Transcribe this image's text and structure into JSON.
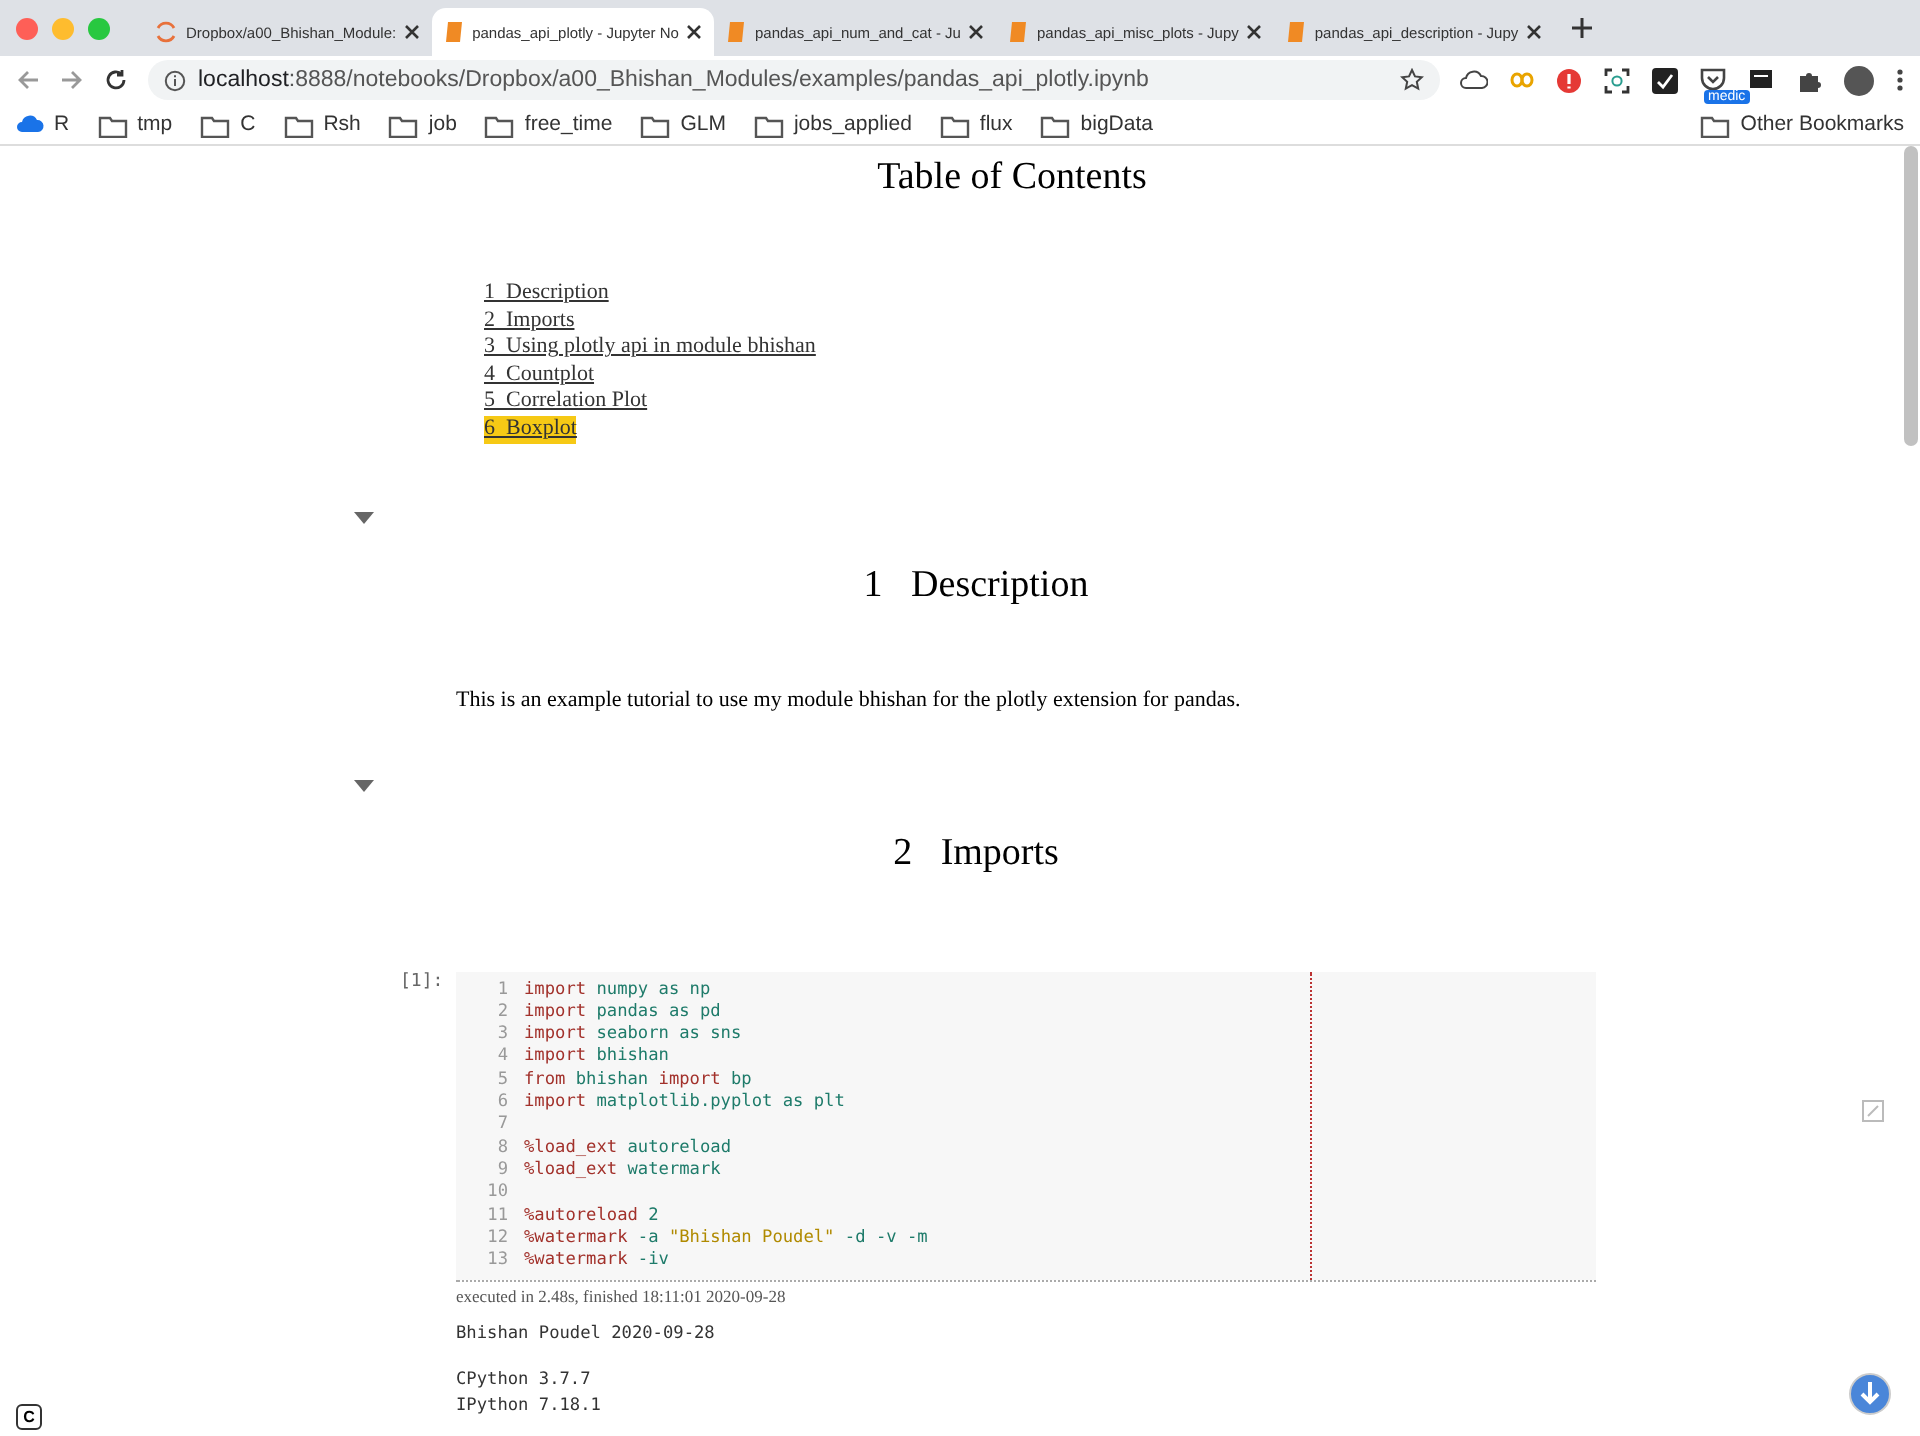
{
  "tabs": [
    {
      "title": "Dropbox/a00_Bhishan_Module:",
      "kind": "loading",
      "selected": false
    },
    {
      "title": "pandas_api_plotly - Jupyter No",
      "kind": "notebook",
      "selected": true
    },
    {
      "title": "pandas_api_num_and_cat - Ju",
      "kind": "notebook",
      "selected": false
    },
    {
      "title": "pandas_api_misc_plots - Jupy",
      "kind": "notebook",
      "selected": false
    },
    {
      "title": "pandas_api_description - Jupy",
      "kind": "notebook",
      "selected": false
    }
  ],
  "address_bar": {
    "host": "localhost",
    "path": ":8888/notebooks/Dropbox/a00_Bhishan_Modules/examples/pandas_api_plotly.ipynb"
  },
  "extension_badge": "medic",
  "bookmarks": [
    {
      "label": "R",
      "kind": "cloud"
    },
    {
      "label": "tmp",
      "kind": "folder"
    },
    {
      "label": "C",
      "kind": "folder"
    },
    {
      "label": "Rsh",
      "kind": "folder"
    },
    {
      "label": "job",
      "kind": "folder"
    },
    {
      "label": "free_time",
      "kind": "folder"
    },
    {
      "label": "GLM",
      "kind": "folder"
    },
    {
      "label": "jobs_applied",
      "kind": "folder"
    },
    {
      "label": "flux",
      "kind": "folder"
    },
    {
      "label": "bigData",
      "kind": "folder"
    }
  ],
  "other_bookmarks": "Other Bookmarks",
  "toc": {
    "title": "Table of Contents",
    "items": [
      {
        "number": "1",
        "label": "Description",
        "selected": false
      },
      {
        "number": "2",
        "label": "Imports",
        "selected": false
      },
      {
        "number": "3",
        "label": "Using plotly api in module bhishan",
        "selected": false
      },
      {
        "number": "4",
        "label": "Countplot",
        "selected": false
      },
      {
        "number": "5",
        "label": "Correlation Plot",
        "selected": false
      },
      {
        "number": "6",
        "label": "Boxplot",
        "selected": true
      }
    ]
  },
  "sections": [
    {
      "number": "1",
      "title": "Description",
      "text": "This is an example tutorial to use my module bhishan for the plotly extension for pandas."
    },
    {
      "number": "2",
      "title": "Imports"
    }
  ],
  "code_cell": {
    "prompt": "[1]:",
    "lines": [
      {
        "number": "1",
        "tokens": [
          {
            "kind": "kw",
            "text": "import"
          },
          {
            "kind": "id",
            "text": " numpy as np"
          }
        ]
      },
      {
        "number": "2",
        "tokens": [
          {
            "kind": "kw",
            "text": "import"
          },
          {
            "kind": "id",
            "text": " pandas as pd"
          }
        ]
      },
      {
        "number": "3",
        "tokens": [
          {
            "kind": "kw",
            "text": "import"
          },
          {
            "kind": "id",
            "text": " seaborn as sns"
          }
        ]
      },
      {
        "number": "4",
        "tokens": [
          {
            "kind": "kw",
            "text": "import"
          },
          {
            "kind": "id",
            "text": " bhishan"
          }
        ]
      },
      {
        "number": "5",
        "tokens": [
          {
            "kind": "kw",
            "text": "from"
          },
          {
            "kind": "id",
            "text": " bhishan "
          },
          {
            "kind": "kw",
            "text": "import"
          },
          {
            "kind": "id",
            "text": " bp"
          }
        ]
      },
      {
        "number": "6",
        "tokens": [
          {
            "kind": "kw",
            "text": "import"
          },
          {
            "kind": "id",
            "text": " matplotlib.pyplot as plt"
          }
        ]
      },
      {
        "number": "7"
      },
      {
        "number": "8",
        "tokens": [
          {
            "kind": "kw",
            "text": "%load_ext"
          },
          {
            "kind": "id",
            "text": " autoreload"
          }
        ]
      },
      {
        "number": "9",
        "tokens": [
          {
            "kind": "kw",
            "text": "%load_ext"
          },
          {
            "kind": "id",
            "text": " watermark"
          }
        ]
      },
      {
        "number": "10"
      },
      {
        "number": "11",
        "tokens": [
          {
            "kind": "kw",
            "text": "%autoreload"
          },
          {
            "kind": "id",
            "text": " 2"
          }
        ]
      },
      {
        "number": "12",
        "tokens": [
          {
            "kind": "kw",
            "text": "%watermark"
          },
          {
            "kind": "id",
            "text": " -a "
          },
          {
            "kind": "str",
            "text": "\"Bhishan Poudel\""
          },
          {
            "kind": "id",
            "text": " -d -v -m"
          }
        ]
      },
      {
        "number": "13",
        "tokens": [
          {
            "kind": "kw",
            "text": "%watermark"
          },
          {
            "kind": "id",
            "text": " -iv"
          }
        ]
      }
    ],
    "execution_note": "executed in 2.48s, finished 18:11:01 2020-09-28",
    "output": [
      [
        "Bhishan Poudel 2020-09-28"
      ],
      [
        "CPython 3.7.7",
        "IPython 7.18.1"
      ]
    ]
  },
  "corner_badge": "C"
}
